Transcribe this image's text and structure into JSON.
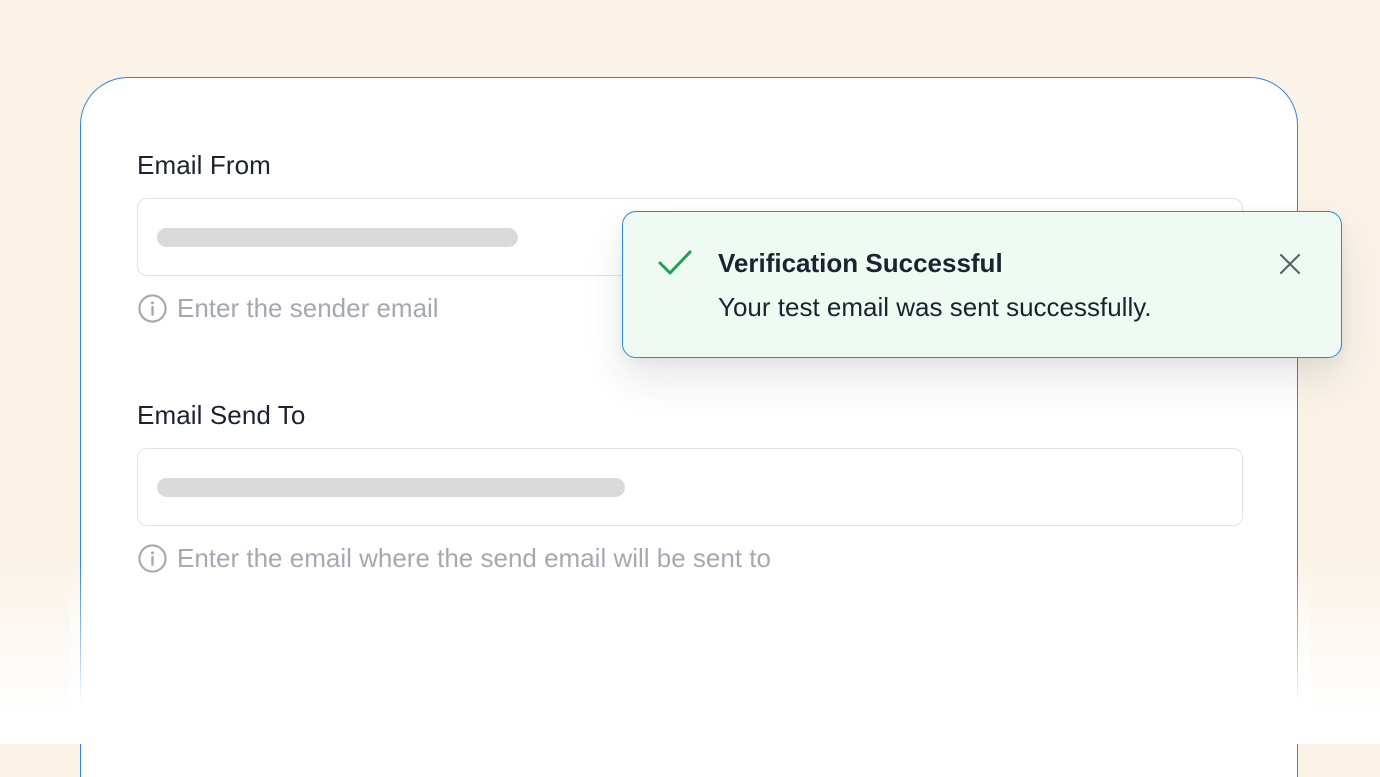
{
  "form": {
    "email_from": {
      "label": "Email From",
      "helper": "Enter the sender email"
    },
    "email_send_to": {
      "label": "Email Send To",
      "helper": "Enter the email where the send email will be sent to"
    }
  },
  "toast": {
    "title": "Verification Successful",
    "message": "Your test email was sent successfully.",
    "icons": {
      "status": "check-icon",
      "close": "close-icon"
    }
  },
  "colors": {
    "accent_border": "#2f86de",
    "success": "#22a050",
    "toast_background": "#effbf2",
    "helper_text": "#a3a8b1",
    "page_background": "#fbf3e8"
  }
}
